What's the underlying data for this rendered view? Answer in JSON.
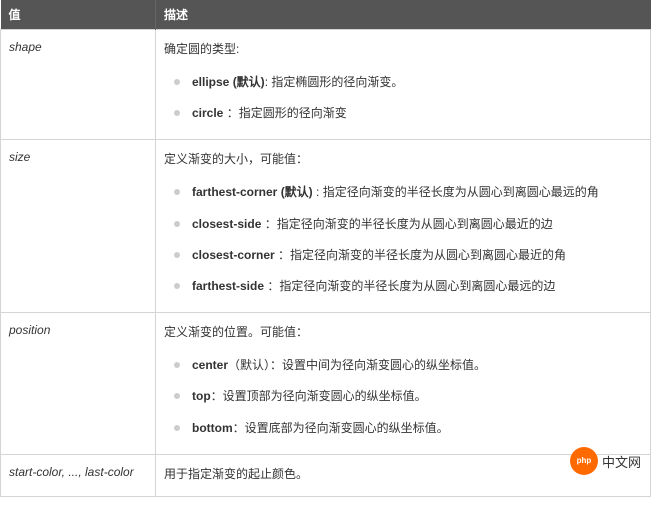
{
  "header": {
    "col_value": "值",
    "col_desc": "描述"
  },
  "rows": [
    {
      "value": "shape",
      "intro": "确定圆的类型:",
      "items": [
        {
          "term": "ellipse (默认)",
          "explain": ": 指定椭圆形的径向渐变。"
        },
        {
          "term": "circle",
          "explain": " ：指定圆形的径向渐变"
        }
      ]
    },
    {
      "value": "size",
      "intro": "定义渐变的大小，可能值：",
      "items": [
        {
          "term": "farthest-corner (默认)",
          "explain": " : 指定径向渐变的半径长度为从圆心到离圆心最远的角"
        },
        {
          "term": "closest-side",
          "explain": " ：指定径向渐变的半径长度为从圆心到离圆心最近的边"
        },
        {
          "term": "closest-corner",
          "explain": " ：指定径向渐变的半径长度为从圆心到离圆心最近的角"
        },
        {
          "term": "farthest-side",
          "explain": " ：指定径向渐变的半径长度为从圆心到离圆心最远的边"
        }
      ]
    },
    {
      "value": "position",
      "intro": "定义渐变的位置。可能值：",
      "items": [
        {
          "term": "center",
          "explain": "（默认）：设置中间为径向渐变圆心的纵坐标值。"
        },
        {
          "term": "top",
          "explain": "：设置顶部为径向渐变圆心的纵坐标值。"
        },
        {
          "term": "bottom",
          "explain": "：设置底部为径向渐变圆心的纵坐标值。"
        }
      ]
    },
    {
      "value": "start-color, ..., last-color",
      "intro": "用于指定渐变的起止颜色。",
      "items": []
    }
  ],
  "logo": {
    "badge": "php",
    "text": "中文网"
  }
}
